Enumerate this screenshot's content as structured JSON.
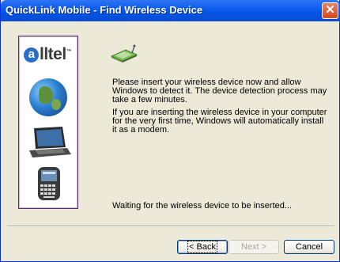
{
  "window": {
    "title": "QuickLink Mobile - Find Wireless Device",
    "close_glyph": "✕"
  },
  "sidebar": {
    "logo_text": "lltel",
    "logo_mark": "a",
    "logo_trademark": "™"
  },
  "content": {
    "paragraph1": "Please insert your wireless device now and allow Windows to detect it.  The device detection process may take a few minutes.",
    "paragraph2": "If you are inserting the wireless device in your computer for the very first time, Windows will automatically install it as a modem.",
    "status": "Waiting for the wireless device to be inserted..."
  },
  "buttons": {
    "back": "< Back",
    "next": "Next >",
    "cancel": "Cancel"
  },
  "icons": {
    "wireless_card": "wireless-card-icon",
    "globe": "globe-icon",
    "laptop": "laptop-icon",
    "phone": "smartphone-icon",
    "close": "close-icon"
  },
  "colors": {
    "titlebar": "#0A5BEC",
    "dialog_bg": "#ECE9D8",
    "panel_border": "#5B2C6F",
    "close_button": "#D5481E"
  }
}
